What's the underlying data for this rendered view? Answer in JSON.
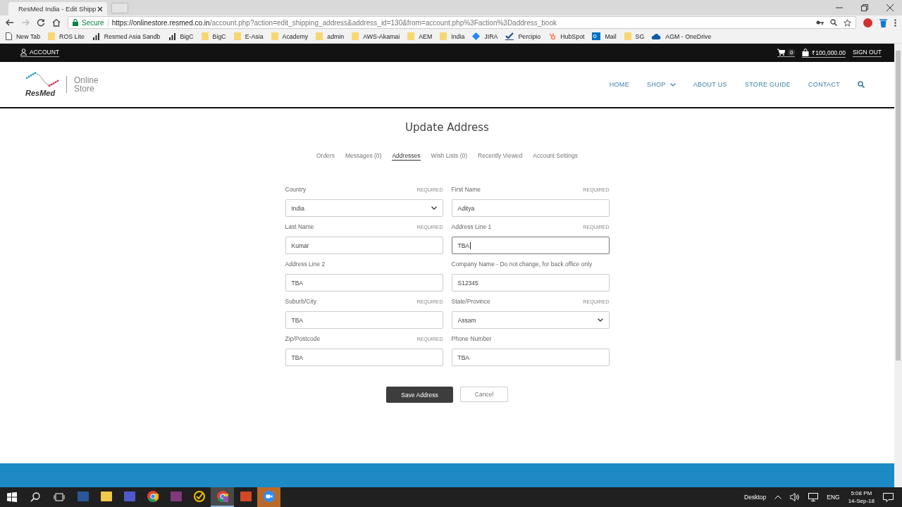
{
  "browser": {
    "tab_title": "ResMed India - Edit Shipp",
    "url_secure": "Secure",
    "url_host": "https://onlinestore.resmed.co.in",
    "url_path": "/account.php?action=edit_shipping_address&address_id=130&from=account.php%3Faction%3Daddress_book",
    "bookmarks": [
      {
        "label": "New Tab",
        "kind": "page"
      },
      {
        "label": "ROS Lite",
        "kind": "folder"
      },
      {
        "label": "Resmed Asia Sandb",
        "kind": "chart"
      },
      {
        "label": "BigC",
        "kind": "chart"
      },
      {
        "label": "BigC",
        "kind": "folder"
      },
      {
        "label": "E-Asia",
        "kind": "folder"
      },
      {
        "label": "Academy",
        "kind": "folder"
      },
      {
        "label": "admin",
        "kind": "folder"
      },
      {
        "label": "AWS-Akamai",
        "kind": "folder"
      },
      {
        "label": "AEM",
        "kind": "folder"
      },
      {
        "label": "India",
        "kind": "folder"
      },
      {
        "label": "JIRA",
        "kind": "diamond"
      },
      {
        "label": "Percipio",
        "kind": "check"
      },
      {
        "label": "HubSpot",
        "kind": "hub"
      },
      {
        "label": "Mail",
        "kind": "mail"
      },
      {
        "label": "SG",
        "kind": "folder"
      },
      {
        "label": "AGM - OneDrive",
        "kind": "cloud"
      }
    ]
  },
  "topbar": {
    "account": "ACCOUNT",
    "cart_count": "0",
    "balance": "₹100,000.00",
    "sign_out": "SIGN OUT"
  },
  "header": {
    "brand": "ResMed",
    "product_line_1": "Online",
    "product_line_2": "Store",
    "nav": [
      {
        "label": "HOME",
        "kind": "link"
      },
      {
        "label": "SHOP",
        "kind": "dropdown"
      },
      {
        "label": "ABOUT US",
        "kind": "link"
      },
      {
        "label": "STORE GUIDE",
        "kind": "link"
      },
      {
        "label": "CONTACT",
        "kind": "link"
      }
    ]
  },
  "title": "Update Address",
  "account_tabs": [
    {
      "label": "Orders",
      "selected": false
    },
    {
      "label": "Messages (0)",
      "selected": false
    },
    {
      "label": "Addresses",
      "selected": true
    },
    {
      "label": "Wish Lists (0)",
      "selected": false
    },
    {
      "label": "Recently Viewed",
      "selected": false
    },
    {
      "label": "Account Settings",
      "selected": false
    }
  ],
  "fields": [
    {
      "label": "Country",
      "required_note": "REQUIRED",
      "kind": "select",
      "value": "India",
      "focused": false
    },
    {
      "label": "First Name",
      "required_note": "REQUIRED",
      "kind": "text",
      "value": "Aditya",
      "focused": false
    },
    {
      "label": "Last Name",
      "required_note": "REQUIRED",
      "kind": "text",
      "value": "Kumar",
      "focused": false
    },
    {
      "label": "Address Line 1",
      "required_note": "REQUIRED",
      "kind": "text",
      "value": "TBA",
      "focused": true
    },
    {
      "label": "Address Line 2",
      "kind": "text",
      "value": "TBA",
      "focused": false
    },
    {
      "label": "Company Name - Do not change, for back office only",
      "kind": "text",
      "value": "S12345",
      "focused": false
    },
    {
      "label": "Suburb/City",
      "required_note": "REQUIRED",
      "kind": "text",
      "value": "TBA",
      "focused": false
    },
    {
      "label": "State/Province",
      "required_note": "REQUIRED",
      "kind": "select",
      "value": "Assam",
      "focused": false
    },
    {
      "label": "Zip/Postcode",
      "required_note": "REQUIRED",
      "kind": "text",
      "value": "TBA",
      "focused": false
    },
    {
      "label": "Phone Number",
      "kind": "text",
      "value": "TBA",
      "focused": false
    }
  ],
  "buttons": {
    "save": "Save Address",
    "cancel": "Cancel"
  },
  "taskbar": {
    "apps": [
      {
        "kind": "visio",
        "active": false
      },
      {
        "kind": "explorer",
        "active": false
      },
      {
        "kind": "teams",
        "active": false
      },
      {
        "kind": "chrome",
        "active": false
      },
      {
        "kind": "onenote",
        "active": false
      },
      {
        "kind": "norton",
        "active": false
      },
      {
        "kind": "chrome-profile",
        "active": true
      },
      {
        "kind": "powerpoint",
        "active": false
      },
      {
        "kind": "zoom",
        "active": false
      }
    ],
    "desktop": "Desktop",
    "language": "ENG",
    "time": "5:08 PM",
    "date": "14-Sep-18"
  }
}
